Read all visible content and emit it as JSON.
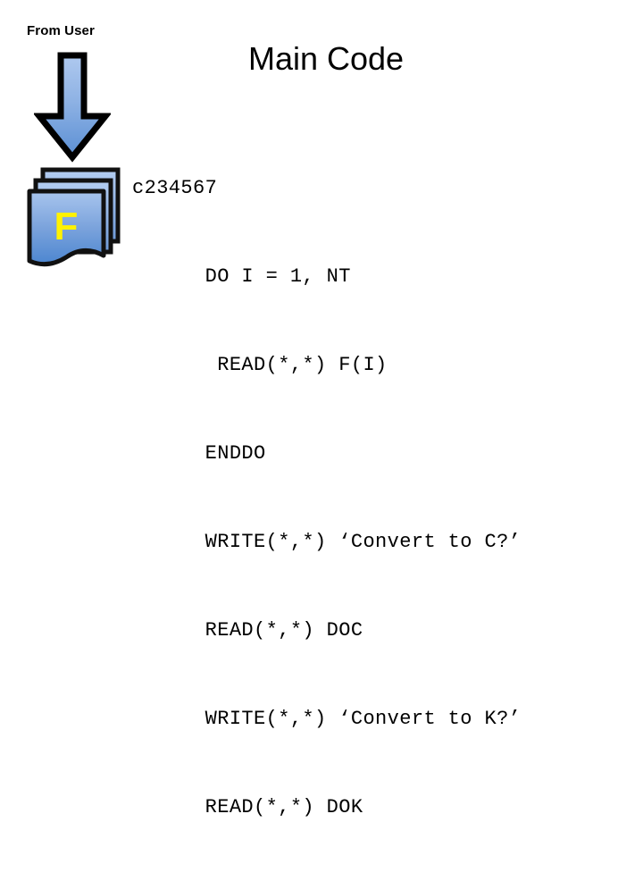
{
  "slide": {
    "title": "Main Code",
    "background_color": "#ffffff"
  },
  "diagram": {
    "from_user_label": "From User",
    "arrow": {
      "icon": "down-arrow-icon",
      "direction": "down",
      "fill_top_color": "#A6C3EC",
      "fill_bottom_color": "#5B8FD4",
      "outline_color": "#000000"
    },
    "document_stack": {
      "icon": "stacked-documents-icon",
      "sheet_count": 3,
      "letter": "F",
      "letter_color": "#FFF200",
      "fill_top_color": "#9CBCEA",
      "fill_bottom_color": "#4C86D0",
      "outline_color": "#1A1A1A"
    }
  },
  "code": {
    "language": "fortran",
    "lines": [
      "c234567",
      "      DO I = 1, NT",
      "       READ(*,*) F(I)",
      "      ENDDO",
      "      WRITE(*,*) ‘Convert to C?’",
      "      READ(*,*) DOC",
      "      WRITE(*,*) ‘Convert to K?’",
      "      READ(*,*) DOK"
    ]
  }
}
